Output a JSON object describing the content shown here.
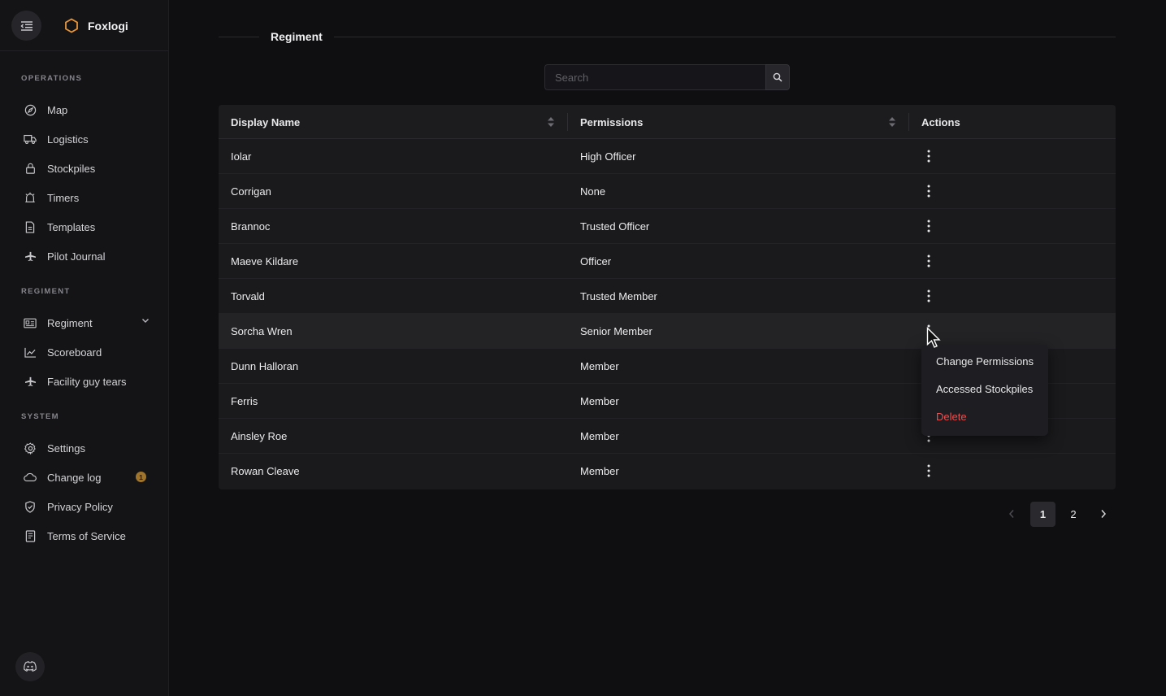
{
  "brand": {
    "name": "Foxlogi",
    "accent": "#e8953a"
  },
  "sidebar": {
    "sections": [
      {
        "label": "OPERATIONS",
        "items": [
          {
            "label": "Map",
            "icon": "compass-icon"
          },
          {
            "label": "Logistics",
            "icon": "truck-icon"
          },
          {
            "label": "Stockpiles",
            "icon": "lock-icon"
          },
          {
            "label": "Timers",
            "icon": "alarm-icon"
          },
          {
            "label": "Templates",
            "icon": "document-icon"
          },
          {
            "label": "Pilot Journal",
            "icon": "plane-icon"
          }
        ]
      },
      {
        "label": "REGIMENT",
        "items": [
          {
            "label": "Regiment",
            "icon": "id-card-icon"
          },
          {
            "label": "Scoreboard",
            "icon": "chart-icon"
          },
          {
            "label": "Facility guy tears",
            "icon": "plane-icon"
          }
        ]
      },
      {
        "label": "SYSTEM",
        "items": [
          {
            "label": "Settings",
            "icon": "gear-icon"
          },
          {
            "label": "Change log",
            "icon": "cloud-icon",
            "badge": "1"
          },
          {
            "label": "Privacy Policy",
            "icon": "shield-icon"
          },
          {
            "label": "Terms of Service",
            "icon": "terms-icon"
          }
        ]
      }
    ]
  },
  "main": {
    "title": "Regiment",
    "search": {
      "placeholder": "Search",
      "value": ""
    },
    "table": {
      "columns": [
        "Display Name",
        "Permissions",
        "Actions"
      ],
      "rows": [
        {
          "name": "Iolar",
          "permission": "High Officer"
        },
        {
          "name": "Corrigan",
          "permission": "None"
        },
        {
          "name": "Brannoc",
          "permission": "Trusted Officer"
        },
        {
          "name": "Maeve Kildare",
          "permission": "Officer"
        },
        {
          "name": "Torvald",
          "permission": "Trusted Member"
        },
        {
          "name": "Sorcha Wren",
          "permission": "Senior Member"
        },
        {
          "name": "Dunn Halloran",
          "permission": "Member"
        },
        {
          "name": "Ferris",
          "permission": "Member"
        },
        {
          "name": "Ainsley Roe",
          "permission": "Member"
        },
        {
          "name": "Rowan Cleave",
          "permission": "Member"
        }
      ]
    },
    "actions_menu": {
      "items": [
        "Change Permissions",
        "Accessed Stockpiles",
        "Delete"
      ]
    },
    "pagination": {
      "current": "1",
      "pages": [
        "1",
        "2"
      ]
    }
  },
  "colors": {
    "danger": "#ec4f4f",
    "badge": "#a0752b",
    "background": "#0f0f11"
  }
}
